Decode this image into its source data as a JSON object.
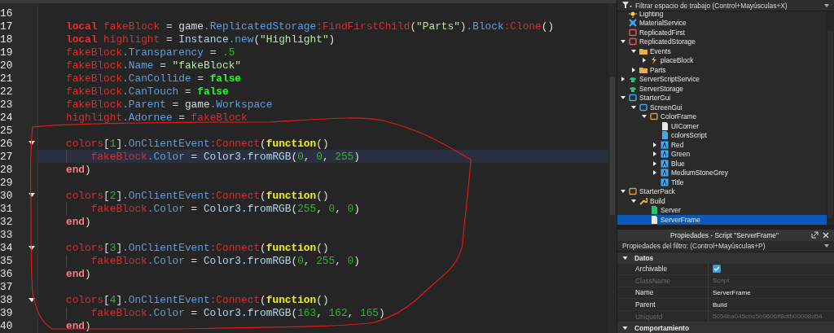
{
  "editor": {
    "lines": [
      {
        "number": "16",
        "fold": false,
        "current": false,
        "indented": false
      },
      {
        "number": "17",
        "fold": false,
        "current": false,
        "indented": false,
        "tokens": [
          {
            "kind": "keyword",
            "text": "local "
          },
          {
            "kind": "var",
            "text": "fakeBlock"
          },
          {
            "kind": "op",
            "text": " = game"
          },
          {
            "kind": "prop",
            "text": ".ReplicatedStorage"
          },
          {
            "kind": "var",
            "text": ":FindFirstChild"
          },
          {
            "kind": "op",
            "text": "("
          },
          {
            "kind": "string",
            "text": "\"Parts\""
          },
          {
            "kind": "op",
            "text": ")"
          },
          {
            "kind": "prop",
            "text": ".Block"
          },
          {
            "kind": "var",
            "text": ":Clone"
          },
          {
            "kind": "op",
            "text": "()"
          }
        ]
      },
      {
        "number": "18",
        "fold": false,
        "current": false,
        "indented": false,
        "tokens": [
          {
            "kind": "keyword",
            "text": "local "
          },
          {
            "kind": "var",
            "text": "highlight"
          },
          {
            "kind": "op",
            "text": " = "
          },
          {
            "kind": "global",
            "text": "Instance"
          },
          {
            "kind": "prop",
            "text": ".new"
          },
          {
            "kind": "op",
            "text": "("
          },
          {
            "kind": "string",
            "text": "\"Highlight\""
          },
          {
            "kind": "op",
            "text": ")"
          }
        ]
      },
      {
        "number": "19",
        "fold": false,
        "current": false,
        "indented": false,
        "tokens": [
          {
            "kind": "var",
            "text": "fakeBlock"
          },
          {
            "kind": "prop",
            "text": ".Transparency"
          },
          {
            "kind": "op",
            "text": " = "
          },
          {
            "kind": "number",
            "text": ".5"
          }
        ]
      },
      {
        "number": "20",
        "fold": false,
        "current": false,
        "indented": false,
        "tokens": [
          {
            "kind": "var",
            "text": "fakeBlock"
          },
          {
            "kind": "prop",
            "text": ".Name"
          },
          {
            "kind": "op",
            "text": " = "
          },
          {
            "kind": "string",
            "text": "\"fakeBlock\""
          }
        ]
      },
      {
        "number": "21",
        "fold": false,
        "current": false,
        "indented": false,
        "tokens": [
          {
            "kind": "var",
            "text": "fakeBlock"
          },
          {
            "kind": "prop",
            "text": ".CanCollide"
          },
          {
            "kind": "op",
            "text": " = "
          },
          {
            "kind": "bool",
            "text": "false"
          }
        ]
      },
      {
        "number": "22",
        "fold": false,
        "current": false,
        "indented": false,
        "tokens": [
          {
            "kind": "var",
            "text": "fakeBlock"
          },
          {
            "kind": "prop",
            "text": ".CanTouch"
          },
          {
            "kind": "op",
            "text": " = "
          },
          {
            "kind": "bool",
            "text": "false"
          }
        ]
      },
      {
        "number": "23",
        "fold": false,
        "current": false,
        "indented": false,
        "tokens": [
          {
            "kind": "var",
            "text": "fakeBlock"
          },
          {
            "kind": "prop",
            "text": ".Parent"
          },
          {
            "kind": "op",
            "text": " = game"
          },
          {
            "kind": "prop",
            "text": ".Workspace"
          }
        ]
      },
      {
        "number": "24",
        "fold": false,
        "current": false,
        "indented": false,
        "tokens": [
          {
            "kind": "var",
            "text": "highlight"
          },
          {
            "kind": "prop",
            "text": ".Adornee"
          },
          {
            "kind": "op",
            "text": " = "
          },
          {
            "kind": "var",
            "text": "fakeBlock"
          }
        ]
      },
      {
        "number": "25",
        "fold": false,
        "current": false,
        "indented": false
      },
      {
        "number": "26",
        "fold": true,
        "current": false,
        "indented": false,
        "tokens": [
          {
            "kind": "var",
            "text": "colors"
          },
          {
            "kind": "op",
            "text": "["
          },
          {
            "kind": "number",
            "text": "1"
          },
          {
            "kind": "op",
            "text": "]"
          },
          {
            "kind": "prop",
            "text": ".OnClientEvent"
          },
          {
            "kind": "var",
            "text": ":Connect"
          },
          {
            "kind": "op",
            "text": "("
          },
          {
            "kind": "function",
            "text": "function"
          },
          {
            "kind": "op",
            "text": "()"
          }
        ]
      },
      {
        "number": "27",
        "fold": false,
        "current": true,
        "indented": true,
        "tokens": [
          {
            "kind": "var",
            "text": "fakeBlock"
          },
          {
            "kind": "prop",
            "text": ".Color"
          },
          {
            "kind": "op",
            "text": " = "
          },
          {
            "kind": "global",
            "text": "Color3.fromRGB"
          },
          {
            "kind": "op",
            "text": "("
          },
          {
            "kind": "number",
            "text": "0"
          },
          {
            "kind": "op",
            "text": ", "
          },
          {
            "kind": "number",
            "text": "0"
          },
          {
            "kind": "op",
            "text": ", "
          },
          {
            "kind": "number",
            "text": "255"
          },
          {
            "kind": "op",
            "text": ")"
          }
        ]
      },
      {
        "number": "28",
        "fold": false,
        "current": false,
        "indented": false,
        "tokens": [
          {
            "kind": "end",
            "text": "end"
          },
          {
            "kind": "op",
            "text": ")"
          }
        ]
      },
      {
        "number": "29",
        "fold": false,
        "current": false,
        "indented": false
      },
      {
        "number": "30",
        "fold": true,
        "current": false,
        "indented": false,
        "tokens": [
          {
            "kind": "var",
            "text": "colors"
          },
          {
            "kind": "op",
            "text": "["
          },
          {
            "kind": "number",
            "text": "2"
          },
          {
            "kind": "op",
            "text": "]"
          },
          {
            "kind": "prop",
            "text": ".OnClientEvent"
          },
          {
            "kind": "var",
            "text": ":Connect"
          },
          {
            "kind": "op",
            "text": "("
          },
          {
            "kind": "function",
            "text": "function"
          },
          {
            "kind": "op",
            "text": "()"
          }
        ]
      },
      {
        "number": "31",
        "fold": false,
        "current": false,
        "indented": true,
        "tokens": [
          {
            "kind": "var",
            "text": "fakeBlock"
          },
          {
            "kind": "prop",
            "text": ".Color"
          },
          {
            "kind": "op",
            "text": " = "
          },
          {
            "kind": "global",
            "text": "Color3.fromRGB"
          },
          {
            "kind": "op",
            "text": "("
          },
          {
            "kind": "number",
            "text": "255"
          },
          {
            "kind": "op",
            "text": ", "
          },
          {
            "kind": "number",
            "text": "0"
          },
          {
            "kind": "op",
            "text": ", "
          },
          {
            "kind": "number",
            "text": "0"
          },
          {
            "kind": "op",
            "text": ")"
          }
        ]
      },
      {
        "number": "32",
        "fold": false,
        "current": false,
        "indented": false,
        "tokens": [
          {
            "kind": "end",
            "text": "end"
          },
          {
            "kind": "op",
            "text": ")"
          }
        ]
      },
      {
        "number": "33",
        "fold": false,
        "current": false,
        "indented": false
      },
      {
        "number": "34",
        "fold": true,
        "current": false,
        "indented": false,
        "tokens": [
          {
            "kind": "var",
            "text": "colors"
          },
          {
            "kind": "op",
            "text": "["
          },
          {
            "kind": "number",
            "text": "3"
          },
          {
            "kind": "op",
            "text": "]"
          },
          {
            "kind": "prop",
            "text": ".OnClientEvent"
          },
          {
            "kind": "var",
            "text": ":Connect"
          },
          {
            "kind": "op",
            "text": "("
          },
          {
            "kind": "function",
            "text": "function"
          },
          {
            "kind": "op",
            "text": "()"
          }
        ]
      },
      {
        "number": "35",
        "fold": false,
        "current": false,
        "indented": true,
        "tokens": [
          {
            "kind": "var",
            "text": "fakeBlock"
          },
          {
            "kind": "prop",
            "text": ".Color"
          },
          {
            "kind": "op",
            "text": " = "
          },
          {
            "kind": "global",
            "text": "Color3.fromRGB"
          },
          {
            "kind": "op",
            "text": "("
          },
          {
            "kind": "number",
            "text": "0"
          },
          {
            "kind": "op",
            "text": ", "
          },
          {
            "kind": "number",
            "text": "255"
          },
          {
            "kind": "op",
            "text": ", "
          },
          {
            "kind": "number",
            "text": "0"
          },
          {
            "kind": "op",
            "text": ")"
          }
        ]
      },
      {
        "number": "36",
        "fold": false,
        "current": false,
        "indented": false,
        "tokens": [
          {
            "kind": "end",
            "text": "end"
          },
          {
            "kind": "op",
            "text": ")"
          }
        ]
      },
      {
        "number": "37",
        "fold": false,
        "current": false,
        "indented": false
      },
      {
        "number": "38",
        "fold": true,
        "current": false,
        "indented": false,
        "tokens": [
          {
            "kind": "var",
            "text": "colors"
          },
          {
            "kind": "op",
            "text": "["
          },
          {
            "kind": "number",
            "text": "4"
          },
          {
            "kind": "op",
            "text": "]"
          },
          {
            "kind": "prop",
            "text": ".OnClientEvent"
          },
          {
            "kind": "var",
            "text": ":Connect"
          },
          {
            "kind": "op",
            "text": "("
          },
          {
            "kind": "function",
            "text": "function"
          },
          {
            "kind": "op",
            "text": "()"
          }
        ]
      },
      {
        "number": "39",
        "fold": false,
        "current": false,
        "indented": true,
        "tokens": [
          {
            "kind": "var",
            "text": "fakeBlock"
          },
          {
            "kind": "prop",
            "text": ".Color"
          },
          {
            "kind": "op",
            "text": " = "
          },
          {
            "kind": "global",
            "text": "Color3.fromRGB"
          },
          {
            "kind": "op",
            "text": "("
          },
          {
            "kind": "number",
            "text": "163"
          },
          {
            "kind": "op",
            "text": ", "
          },
          {
            "kind": "number",
            "text": "162"
          },
          {
            "kind": "op",
            "text": ", "
          },
          {
            "kind": "number",
            "text": "165"
          },
          {
            "kind": "op",
            "text": ")"
          }
        ]
      },
      {
        "number": "40",
        "fold": false,
        "current": false,
        "indented": false,
        "tokens": [
          {
            "kind": "end",
            "text": "end"
          },
          {
            "kind": "op",
            "text": ")"
          }
        ]
      }
    ]
  },
  "explorer": {
    "filter_placeholder": "Filtrar espacio de trabajo (Control+Mayúsculas+X)",
    "items": [
      {
        "name": "Lighting",
        "kind": "light",
        "selected": false
      },
      {
        "name": "MaterialService",
        "kind": "material",
        "selected": false
      },
      {
        "name": "ReplicatedFirst",
        "kind": "replicated",
        "selected": false
      },
      {
        "name": "ReplicatedStorage",
        "kind": "replicated",
        "selected": false,
        "expanded": true,
        "children": [
          {
            "name": "Events",
            "kind": "folder",
            "selected": false,
            "expanded": true,
            "children": [
              {
                "name": "placeBlock",
                "kind": "event",
                "selected": false,
                "expanded": false
              }
            ]
          },
          {
            "name": "Parts",
            "kind": "folder",
            "selected": false,
            "expanded": false
          }
        ]
      },
      {
        "name": "ServerScriptService",
        "kind": "server",
        "selected": false,
        "expanded": false
      },
      {
        "name": "ServerStorage",
        "kind": "server",
        "selected": false
      },
      {
        "name": "StarterGui",
        "kind": "gui",
        "selected": false,
        "expanded": true,
        "children": [
          {
            "name": "ScreenGui",
            "kind": "screen",
            "selected": false,
            "expanded": true,
            "children": [
              {
                "name": "ColorFrame",
                "kind": "frame",
                "selected": false,
                "expanded": true,
                "children": [
                  {
                    "name": "UICorner",
                    "kind": "page",
                    "selected": false
                  },
                  {
                    "name": "colorsScript",
                    "kind": "localscript",
                    "selected": false
                  },
                  {
                    "name": "Red",
                    "kind": "textbutton",
                    "selected": false,
                    "expanded": false
                  },
                  {
                    "name": "Green",
                    "kind": "textbutton",
                    "selected": false,
                    "expanded": false
                  },
                  {
                    "name": "Blue",
                    "kind": "textbutton",
                    "selected": false,
                    "expanded": false
                  },
                  {
                    "name": "MediumStoneGrey",
                    "kind": "textbutton",
                    "selected": false,
                    "expanded": false
                  },
                  {
                    "name": "Title",
                    "kind": "textlabel",
                    "selected": false
                  }
                ]
              }
            ]
          }
        ]
      },
      {
        "name": "StarterPack",
        "kind": "pack",
        "selected": false,
        "expanded": true,
        "children": [
          {
            "name": "Build",
            "kind": "tool",
            "selected": false,
            "expanded": true,
            "children": [
              {
                "name": "Server",
                "kind": "script",
                "selected": false
              },
              {
                "name": "ServerFrame",
                "kind": "page",
                "selected": true
              }
            ]
          }
        ]
      }
    ]
  },
  "properties": {
    "title": "Propiedades - Script \"ServerFrame\"",
    "filter_placeholder": "Propiedades del filtro: (Control+Mayúsculas+P)",
    "sections": [
      {
        "name": "Datos",
        "expanded": true,
        "rows": [
          {
            "name": "Archivable",
            "kind": "checkbox",
            "checked": true,
            "disabled": false
          },
          {
            "name": "ClassName",
            "kind": "text",
            "value": "Script",
            "disabled": true
          },
          {
            "name": "Name",
            "kind": "text",
            "value": "ServerFrame",
            "disabled": false
          },
          {
            "name": "Parent",
            "kind": "text",
            "value": "Build",
            "disabled": false
          },
          {
            "name": "UniqueId",
            "kind": "text",
            "value": "5054ba045cbc5b9606ff8dfb00008d54",
            "disabled": true
          }
        ]
      },
      {
        "name": "Comportamiento",
        "expanded": true
      }
    ]
  }
}
